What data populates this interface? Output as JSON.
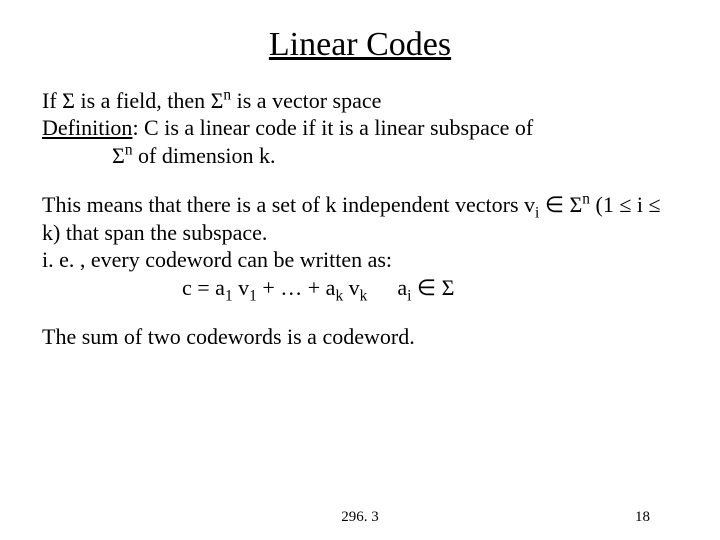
{
  "title": "Linear Codes",
  "p1_a": "If ",
  "p1_b": " is a field, then ",
  "p1_c": " is a vector space",
  "def_label": "Definition",
  "def_a": ": C is a linear code if it is a linear subspace of ",
  "def_b": " of dimension k.",
  "p2_a": "This means that there is a set of k independent vectors v",
  "p2_b": " ",
  "p2_mem": "∈",
  "p2_c": " (1 ",
  "p2_le1": "≤",
  "p2_d": " i ",
  "p2_le2": "≤",
  "p2_e": " k) that span the subspace.",
  "p3": "i. e. , every codeword can be written as:",
  "eq_a": "c = a",
  "eq_b": " v",
  "eq_c": " + … + a",
  "eq_d": " v",
  "eq_ai": "a",
  "eq_in": " ∈ ",
  "p4": "The sum of two codewords is a codeword.",
  "footer_center": "296. 3",
  "footer_right": "18",
  "sigma": "Σ",
  "n": "n",
  "i": "i",
  "one": "1",
  "k": "k"
}
